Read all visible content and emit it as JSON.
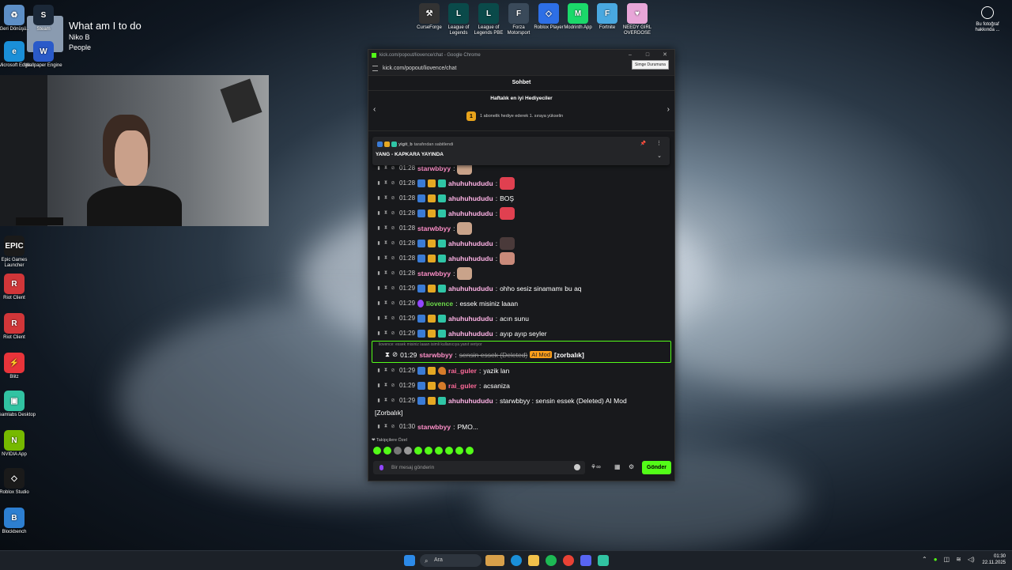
{
  "desktop": {
    "left_icons": [
      {
        "label": "Geri Dönüşü..",
        "color": "#5d8fc7",
        "glyph": "♻"
      },
      {
        "label": "Steam",
        "color": "#1b2838",
        "glyph": "S"
      },
      {
        "label": "Microsoft Edge",
        "color": "#1a8fd8",
        "glyph": "e"
      },
      {
        "label": "Wallpaper Engine",
        "color": "#2a5ac9",
        "glyph": "W"
      },
      {
        "label": "Epic Games Launcher",
        "color": "#1a1a1a",
        "glyph": "EPIC"
      },
      {
        "label": "Riot Client",
        "color": "#d13639",
        "glyph": "R"
      },
      {
        "label": "Riot Client",
        "color": "#d13639",
        "glyph": "R"
      },
      {
        "label": "Blitz",
        "color": "#e8343a",
        "glyph": "⚡"
      },
      {
        "label": "Streamlabs Desktop",
        "color": "#31c3a2",
        "glyph": "▣"
      },
      {
        "label": "NVIDIA App",
        "color": "#76b900",
        "glyph": "N"
      },
      {
        "label": "Roblox Studio",
        "color": "#1a1a1a",
        "glyph": "◇"
      },
      {
        "label": "Blockbench",
        "color": "#2d7fd1",
        "glyph": "B"
      }
    ],
    "top_icons": [
      {
        "label": "CurseForge",
        "color": "#333",
        "glyph": "⚒"
      },
      {
        "label": "League of Legends",
        "color": "#0a4a4a",
        "glyph": "L"
      },
      {
        "label": "League of Legends PBE",
        "color": "#0a4a4a",
        "glyph": "L"
      },
      {
        "label": "Forza Motorsport",
        "color": "#3a4a5a",
        "glyph": "F"
      },
      {
        "label": "Roblox Player",
        "color": "#2d6fe6",
        "glyph": "◇"
      },
      {
        "label": "Modrinth App",
        "color": "#1bd96a",
        "glyph": "M"
      },
      {
        "label": "Fortnite",
        "color": "#49a8e0",
        "glyph": "F"
      },
      {
        "label": "NEEDY GIRL OVERDOSE",
        "color": "#e8a6d8",
        "glyph": "♥"
      }
    ],
    "photo_info": "Bu fotoğraf hakkında ..."
  },
  "spotify": {
    "title": "What am I to do",
    "artist": "Niko B",
    "playlist": "People"
  },
  "browser": {
    "title": "kick.com/popout/liovence/chat - Google Chrome",
    "url": "kick.com/popout/liovence/chat",
    "tooltip": "Simge Durumuna",
    "chat_title": "Sohbet",
    "gifters_title": "Haftalık en iyi Hediyeciler",
    "gifters_rank": "1",
    "gifters_sub": "1 abonelik hediye ederek 1. sıraya yükselin",
    "pinned_by_user": "yigit_b",
    "pinned_by_suffix": "tarafından sabitlendi",
    "pinned_message": "YANG - KAPKARA YAYINDA",
    "messages": [
      {
        "time": "01:28",
        "user": "starwbbyy",
        "color": "#ff8fc8",
        "badges": [],
        "text": "",
        "emote": "#c9a38a"
      },
      {
        "time": "01:28",
        "user": "ahuhuhududu",
        "color": "#ffb3e6",
        "badges": [
          "blue",
          "gold",
          "teal"
        ],
        "text": "",
        "emote": "#e04050"
      },
      {
        "time": "01:28",
        "user": "ahuhuhududu",
        "color": "#ffb3e6",
        "badges": [
          "blue",
          "gold",
          "teal"
        ],
        "text": "BOŞ",
        "emote": ""
      },
      {
        "time": "01:28",
        "user": "ahuhuhududu",
        "color": "#ffb3e6",
        "badges": [
          "blue",
          "gold",
          "teal"
        ],
        "text": "",
        "emote": "#e04050"
      },
      {
        "time": "01:28",
        "user": "starwbbyy",
        "color": "#ff8fc8",
        "badges": [],
        "text": "",
        "emote": "#c9a38a"
      },
      {
        "time": "01:28",
        "user": "ahuhuhududu",
        "color": "#ffb3e6",
        "badges": [
          "blue",
          "gold",
          "teal"
        ],
        "text": "",
        "emote": "#4a3a3a"
      },
      {
        "time": "01:28",
        "user": "ahuhuhududu",
        "color": "#ffb3e6",
        "badges": [
          "blue",
          "gold",
          "teal"
        ],
        "text": "",
        "emote": "#c98a7a"
      },
      {
        "time": "01:28",
        "user": "starwbbyy",
        "color": "#ff8fc8",
        "badges": [],
        "text": "",
        "emote": "#c9a38a"
      },
      {
        "time": "01:29",
        "user": "ahuhuhududu",
        "color": "#ffb3e6",
        "badges": [
          "blue",
          "gold",
          "teal"
        ],
        "text": "ohho sesiz sinamamı bu aq",
        "emote": ""
      },
      {
        "time": "01:29",
        "user": "liovence",
        "color": "#6ddc4a",
        "badges": [
          "purple"
        ],
        "text": "essek misiniz laaan",
        "emote": ""
      },
      {
        "time": "01:29",
        "user": "ahuhuhududu",
        "color": "#ffb3e6",
        "badges": [
          "blue",
          "gold",
          "teal"
        ],
        "text": "acın sunu",
        "emote": ""
      },
      {
        "time": "01:29",
        "user": "ahuhuhududu",
        "color": "#ffb3e6",
        "badges": [
          "blue",
          "gold",
          "teal"
        ],
        "text": "ayıp ayıp seyler",
        "emote": ""
      }
    ],
    "highlight": {
      "reply_to": "liovence: essek misiniz laaan isimli kullanıcıya yanıt veriyor",
      "time": "01:29",
      "user": "starwbbyy",
      "deleted_text": "sensin essek (Deleted)",
      "mod_label": "AI Mod",
      "reason": "[zorbalık]"
    },
    "messages2": [
      {
        "time": "01:29",
        "user": "rai_guler",
        "color": "#ff6a9a",
        "badges": [
          "blue",
          "gold",
          "bird"
        ],
        "text": "yazik lan"
      },
      {
        "time": "01:29",
        "user": "rai_guler",
        "color": "#ff6a9a",
        "badges": [
          "blue",
          "gold",
          "bird"
        ],
        "text": "acsaniza"
      },
      {
        "time": "01:29",
        "user": "ahuhuhududu",
        "color": "#ffb3e6",
        "badges": [
          "blue",
          "gold",
          "teal"
        ],
        "text": "starwbbyy : sensin essek (Deleted) AI Mod"
      }
    ],
    "wrap_text": "[Zorbalık]",
    "last_message": {
      "time": "01:30",
      "user": "starwbbyy",
      "color": "#ff8fc8",
      "text": "PMO..."
    },
    "followers_only": "❤ Takipçilere Özel",
    "input_placeholder": "Bir mesaj gönderin",
    "send_label": "Gönder"
  },
  "taskbar": {
    "search_placeholder": "Ara",
    "time": "01:30",
    "date": "22.11.2025"
  }
}
